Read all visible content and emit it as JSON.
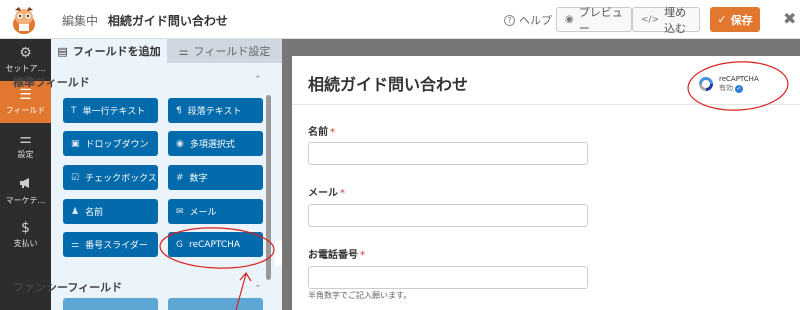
{
  "header": {
    "editing_label": "編集中",
    "form_title": "相続ガイド問い合わせ",
    "help_label": "ヘルプ",
    "preview_label": "プレビュー",
    "embed_label": "埋め込む",
    "save_label": "保存",
    "close_glyph": "✖"
  },
  "leftnav": {
    "items": [
      {
        "label": "セットアップ",
        "display": "セットア…",
        "icon": "gear-icon",
        "glyph": "⚙"
      },
      {
        "label": "フィールド",
        "icon": "fields-icon",
        "glyph": "☰",
        "active": true
      },
      {
        "label": "設定",
        "icon": "sliders-icon",
        "glyph": "⚌"
      },
      {
        "label": "マーケティング",
        "display": "マーケテ…",
        "icon": "megaphone-icon",
        "glyph": "📢"
      },
      {
        "label": "支払い",
        "icon": "dollar-icon",
        "glyph": "$"
      }
    ]
  },
  "panel": {
    "tabs": [
      {
        "label": "フィールドを追加",
        "icon": "list-icon",
        "glyph": "▤"
      },
      {
        "label": "フィールド設定",
        "icon": "sliders-icon",
        "glyph": "⚌"
      }
    ],
    "standard_heading": "標準フィールド",
    "fancy_heading": "ファンシーフィールド",
    "fields": [
      {
        "label": "単一行テキスト",
        "icon": "text-icon",
        "glyph": "T"
      },
      {
        "label": "段落テキスト",
        "icon": "paragraph-icon",
        "glyph": "¶"
      },
      {
        "label": "ドロップダウン",
        "icon": "dropdown-icon",
        "glyph": "▣"
      },
      {
        "label": "多項選択式",
        "icon": "radio-icon",
        "glyph": "◉"
      },
      {
        "label": "チェックボックス",
        "icon": "checkbox-icon",
        "glyph": "☑"
      },
      {
        "label": "数字",
        "icon": "hash-icon",
        "glyph": "#"
      },
      {
        "label": "名前",
        "icon": "user-icon",
        "glyph": "♟"
      },
      {
        "label": "メール",
        "icon": "envelope-icon",
        "glyph": "✉"
      },
      {
        "label": "番号スライダー",
        "icon": "slider-icon",
        "glyph": "⚌"
      },
      {
        "label": "reCAPTCHA",
        "icon": "google-icon",
        "glyph": "G"
      }
    ]
  },
  "preview": {
    "title": "相続ガイド問い合わせ",
    "recaptcha_label": "reCAPTCHA",
    "recaptcha_status": "有効",
    "fields": [
      {
        "label": "名前",
        "required": "*"
      },
      {
        "label": "メール",
        "required": "*"
      },
      {
        "label": "お電話番号",
        "required": "*"
      }
    ],
    "phone_desc": "半角数字でご記入願います。"
  },
  "colors": {
    "accent": "#e27730",
    "field_button": "#036aab",
    "nav_bg": "#2d2d2d",
    "annotation": "#d9221e"
  }
}
